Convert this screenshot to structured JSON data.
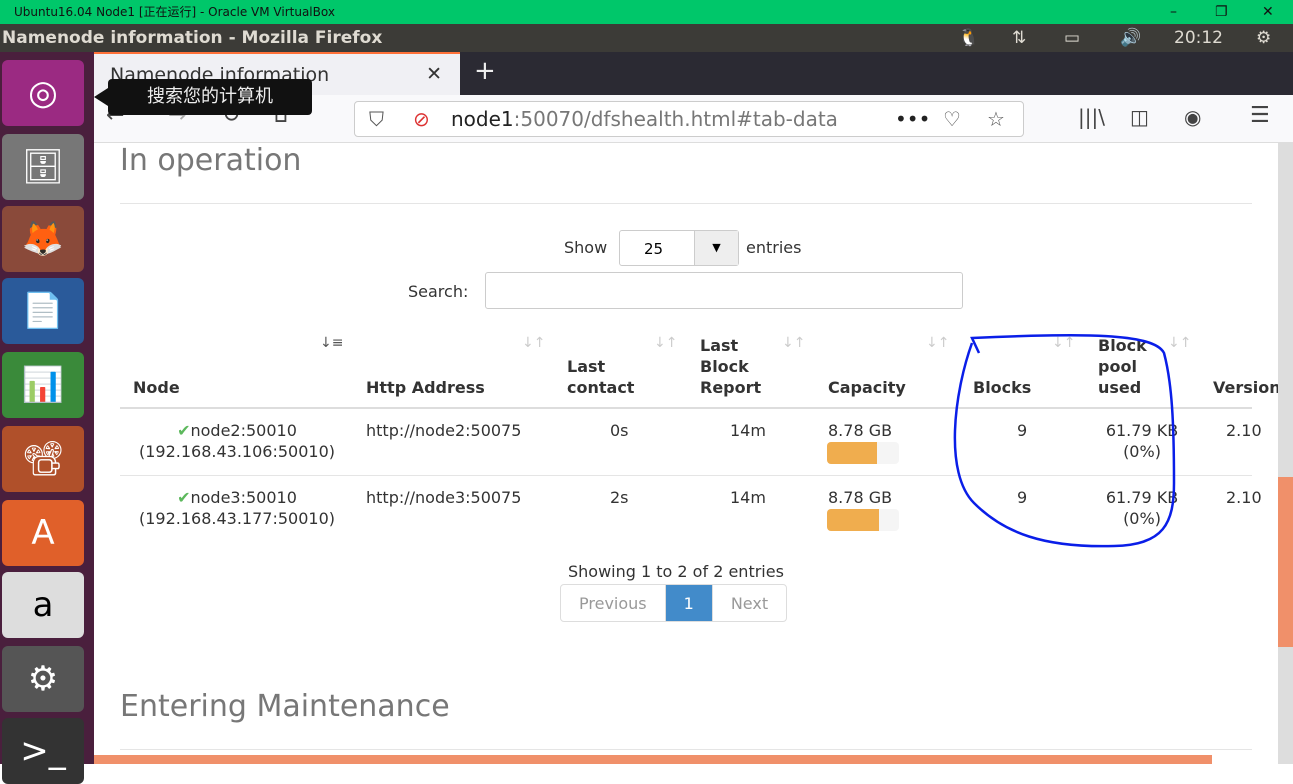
{
  "vbox": {
    "title": "Ubuntu16.04 Node1 [正在运行] - Oracle VM VirtualBox"
  },
  "panel": {
    "title": "Namenode information - Mozilla Firefox",
    "time": "20:12"
  },
  "launcher": {
    "tooltip": "搜索您的计算机"
  },
  "browser": {
    "tab_title": "Namenode information",
    "url_host": "node1",
    "url_rest": ":50070/dfshealth.html#tab-data"
  },
  "page": {
    "section1": "In operation",
    "show_label": "Show",
    "show_value": "25",
    "entries_label": "entries",
    "search_label": "Search:",
    "search_value": "",
    "columns": [
      "Node",
      "Http Address",
      "Last contact",
      "Last Block Report",
      "Capacity",
      "Blocks",
      "Block pool used",
      "Version"
    ],
    "rows": [
      {
        "node": "node2:50010",
        "ip": "(192.168.43.106:50010)",
        "http": "http://node2:50075",
        "contact": "0s",
        "report": "14m",
        "capacity": "8.78 GB",
        "used_pct": 70,
        "blocks": "9",
        "pool": "61.79 KB",
        "pool_pct": "(0%)",
        "version": "2.10"
      },
      {
        "node": "node3:50010",
        "ip": "(192.168.43.177:50010)",
        "http": "http://node3:50075",
        "contact": "2s",
        "report": "14m",
        "capacity": "8.78 GB",
        "used_pct": 72,
        "blocks": "9",
        "pool": "61.79 KB",
        "pool_pct": "(0%)",
        "version": "2.10"
      }
    ],
    "info": "Showing 1 to 2 of 2 entries",
    "pager": {
      "prev": "Previous",
      "page": "1",
      "next": "Next"
    },
    "section2": "Entering Maintenance"
  }
}
